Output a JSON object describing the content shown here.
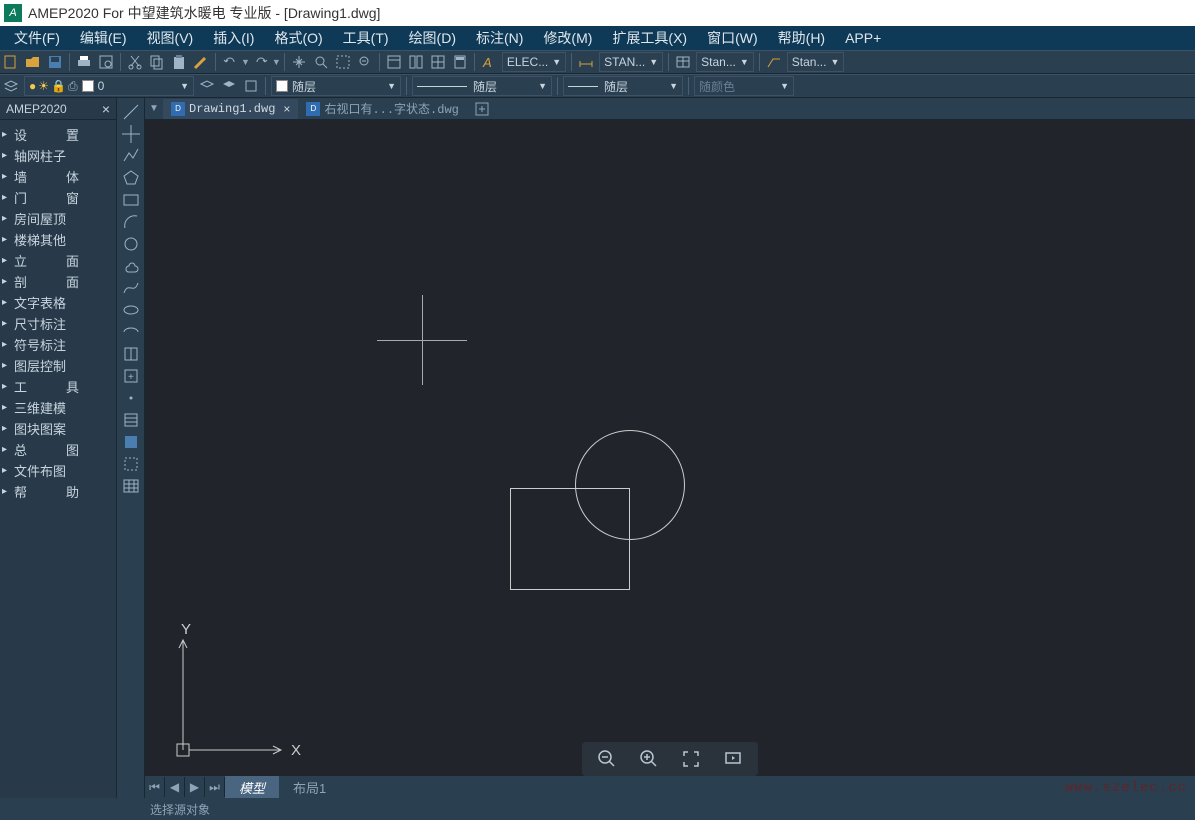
{
  "title": "AMEP2020 For 中望建筑水暖电 专业版 - [Drawing1.dwg]",
  "menubar": [
    "文件(F)",
    "编辑(E)",
    "视图(V)",
    "插入(I)",
    "格式(O)",
    "工具(T)",
    "绘图(D)",
    "标注(N)",
    "修改(M)",
    "扩展工具(X)",
    "窗口(W)",
    "帮助(H)",
    "APP+"
  ],
  "toolbar1": {
    "layer_num": "0",
    "style1_label": "ELEC...",
    "style2_label": "STAN...",
    "style3_label": "Stan...",
    "style4_label": "Stan..."
  },
  "toolbar2": {
    "layer_dd": "随层",
    "linetype_dd": "随层",
    "lineweight_dd": "随层",
    "color_dd": "随颜色"
  },
  "sidepanel": {
    "title": "AMEP2020",
    "items": [
      "设　　　置",
      "轴网柱子",
      "墙　　　体",
      "门　　　窗",
      "房间屋顶",
      "楼梯其他",
      "立　　　面",
      "剖　　　面",
      "文字表格",
      "尺寸标注",
      "符号标注",
      "图层控制",
      "工　　　具",
      "三维建模",
      "图块图案",
      "总　　　图",
      "文件布图",
      "帮　　　助"
    ]
  },
  "filetabs": {
    "active": "Drawing1.dwg",
    "inactive": "右视口有...字状态.dwg"
  },
  "bottomtabs": {
    "model": "模型",
    "layout1": "布局1"
  },
  "ucs": {
    "x": "X",
    "y": "Y"
  },
  "statusbar": "选择源对象",
  "watermark": "www.szelec.cc"
}
